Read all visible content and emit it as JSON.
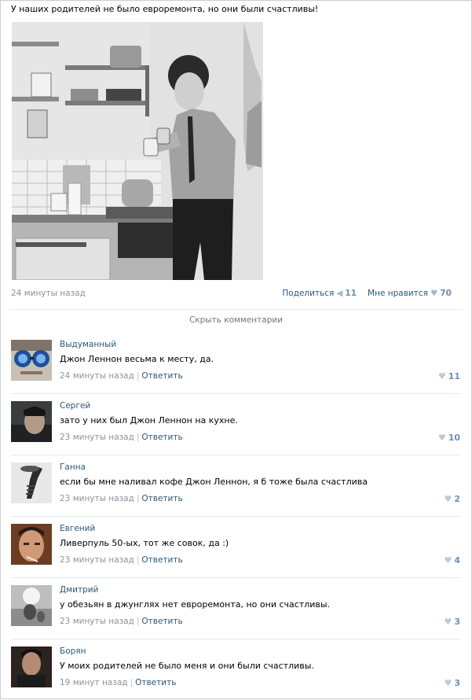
{
  "post": {
    "text": "У наших родителей не было евроремонта, но они были счастливы!",
    "time": "24 минуты назад",
    "share_label": "Поделиться",
    "share_count": "11",
    "like_label": "Мне нравится",
    "like_count": "70",
    "hide_comments": "Скрыть комментарии"
  },
  "comments": [
    {
      "author": "Выдуманный",
      "text": "Джон Леннон весьма к месту, да.",
      "time": "24 минуты назад",
      "reply": "Ответить",
      "likes": "11"
    },
    {
      "author": "Сергей",
      "text": "зато у них был Джон Леннон на кухне.",
      "time": "23 минуты назад",
      "reply": "Ответить",
      "likes": "10"
    },
    {
      "author": "Ганна",
      "text": "если бы мне наливал кофе Джон Леннон, я б тоже была счастлива",
      "time": "23 минуты назад",
      "reply": "Ответить",
      "likes": "2"
    },
    {
      "author": "Евгений",
      "text": "Ливерпуль 50-ых, тот же совок, да :)",
      "time": "23 минуты назад",
      "reply": "Ответить",
      "likes": "4"
    },
    {
      "author": "Дмитрий",
      "text": "у обезьян в джунглях нет евроремонта, но они счастливы.",
      "time": "23 минуты назад",
      "reply": "Ответить",
      "likes": "3"
    },
    {
      "author": "Борян",
      "text": "У моих родителей не было меня и они были счастливы.",
      "time": "19 минут назад",
      "reply": "Ответить",
      "likes": "3"
    }
  ],
  "icons": {
    "share": "megaphone-icon",
    "like": "heart-icon"
  },
  "colors": {
    "link": "#2b587a",
    "muted": "#8a939d",
    "like_count": "#6d8fb3"
  }
}
